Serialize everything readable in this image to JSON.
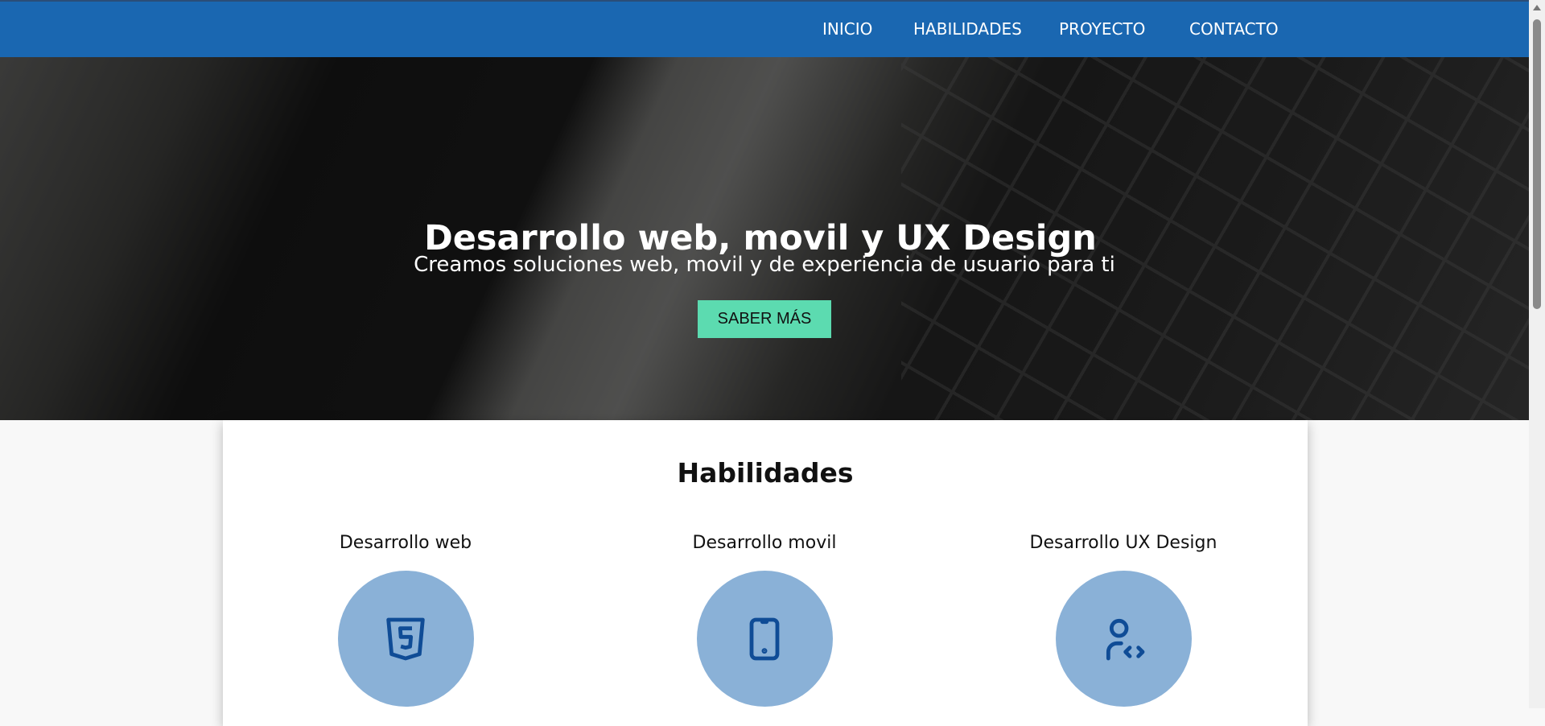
{
  "nav": {
    "items": [
      "INICIO",
      "HABILIDADES",
      "PROYECTO",
      "CONTACTO"
    ]
  },
  "hero": {
    "title": "Desarrollo web, movil y UX Design",
    "subtitle": "Creamos soluciones web, movil y de experiencia de usuario para ti",
    "button": "SABER MÁS"
  },
  "skills": {
    "title": "Habilidades",
    "items": [
      {
        "label": "Desarrollo web",
        "icon": "html5-icon"
      },
      {
        "label": "Desarrollo movil",
        "icon": "smartphone-icon"
      },
      {
        "label": "Desarrollo UX Design",
        "icon": "user-code-icon"
      }
    ]
  },
  "colors": {
    "nav": "#1a67b1",
    "button": "#5cdbb0",
    "circle": "#8ab1d7",
    "icon": "#0f4c96"
  }
}
